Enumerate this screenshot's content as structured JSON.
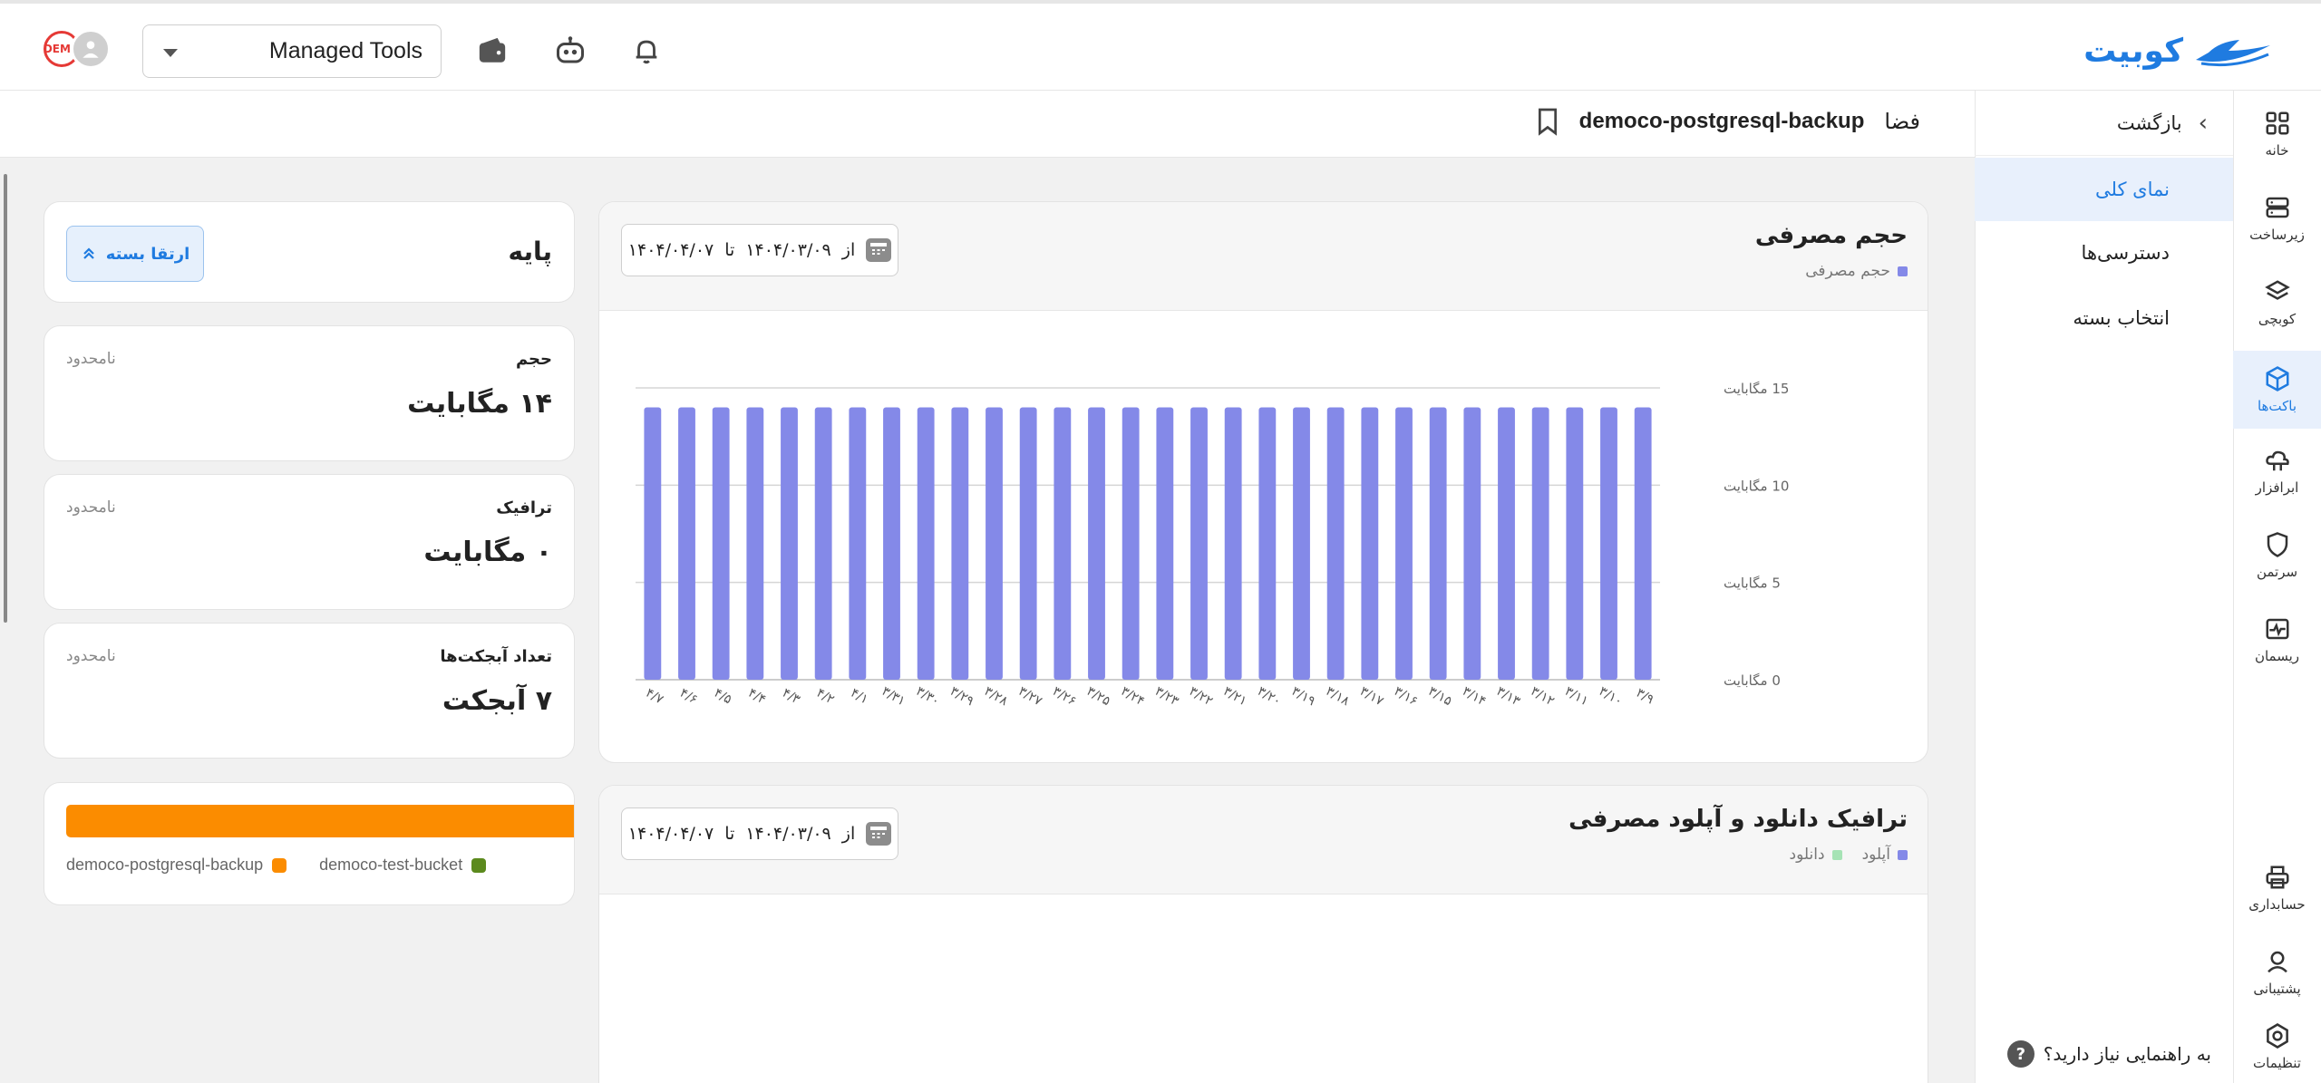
{
  "brand": {
    "name": "کوبیت",
    "color": "#1f7be0"
  },
  "header": {
    "org_select": "Managed Tools",
    "avatar_badge": "DEMO",
    "icons": [
      "wallet-icon",
      "robot-icon",
      "bell-icon"
    ]
  },
  "rail": {
    "items": [
      {
        "label": "خانه",
        "icon": "grid-icon",
        "active": false
      },
      {
        "label": "زیرساخت",
        "icon": "server-icon",
        "active": false
      },
      {
        "label": "کوبچی",
        "icon": "layers-icon",
        "active": false
      },
      {
        "label": "باکت‌ها",
        "icon": "box-icon",
        "active": true
      },
      {
        "label": "ابرافزار",
        "icon": "cloud-icon",
        "active": false
      },
      {
        "label": "سرتمن",
        "icon": "shield-icon",
        "active": false
      },
      {
        "label": "ریسمان",
        "icon": "pulse-icon",
        "active": false
      },
      {
        "label": "حسابداری",
        "icon": "printer-icon",
        "active": false
      },
      {
        "label": "پشتیبانی",
        "icon": "headset-icon",
        "active": false
      },
      {
        "label": "تنظیمات",
        "icon": "settings-icon",
        "active": false
      }
    ]
  },
  "subnav": {
    "back_label": "بازگشت",
    "items": [
      {
        "label": "نمای کلی",
        "active": true
      },
      {
        "label": "دسترسی‌ها",
        "active": false
      },
      {
        "label": "انتخاب بسته",
        "active": false
      }
    ],
    "help": "به راهنمایی نیاز دارید؟"
  },
  "breadcrumb": {
    "prefix": "فضا",
    "bucket": "democo-postgresql-backup"
  },
  "plan": {
    "name": "پایه",
    "upgrade_label": "ارتقا بسته"
  },
  "stats": [
    {
      "label": "حجم",
      "limit": "نامحدود",
      "value": "۱۴ مگابایت"
    },
    {
      "label": "ترافیک",
      "limit": "نامحدود",
      "value": "۰ مگابایت"
    },
    {
      "label": "تعداد آبجکت‌ها",
      "limit": "نامحدود",
      "value": "۷ آبجکت"
    }
  ],
  "bucket_usage": {
    "fill_fraction": 1.0,
    "fill_color": "#fb8c00",
    "legend": [
      {
        "name": "democo-test-bucket",
        "color": "#5c8a1e"
      },
      {
        "name": "democo-postgresql-backup",
        "color": "#fb8c00"
      }
    ]
  },
  "usage_chart": {
    "title": "حجم مصرفی",
    "legend": "حجم مصرفی",
    "date_from_label": "از",
    "date_from": "۱۴۰۴/۰۳/۰۹",
    "date_to_label": "تا",
    "date_to": "۱۴۰۴/۰۴/۰۷"
  },
  "traffic_chart": {
    "title": "ترافیک دانلود و آپلود مصرفی",
    "legend": [
      {
        "name": "آپلود",
        "color": "#8489e8"
      },
      {
        "name": "دانلود",
        "color": "#a6e3b5"
      }
    ],
    "date_from_label": "از",
    "date_from": "۱۴۰۴/۰۳/۰۹",
    "date_to_label": "تا",
    "date_to": "۱۴۰۴/۰۴/۰۷"
  },
  "chart_data": {
    "type": "bar",
    "title": "حجم مصرفی",
    "xlabel": "",
    "ylabel": "",
    "categories": [
      "۳/۹",
      "۳/۱۰",
      "۳/۱۱",
      "۳/۱۲",
      "۳/۱۳",
      "۳/۱۴",
      "۳/۱۵",
      "۳/۱۶",
      "۳/۱۷",
      "۳/۱۸",
      "۳/۱۹",
      "۳/۲۰",
      "۳/۲۱",
      "۳/۲۲",
      "۳/۲۳",
      "۳/۲۴",
      "۳/۲۵",
      "۳/۲۶",
      "۳/۲۷",
      "۳/۲۸",
      "۳/۲۹",
      "۳/۳۰",
      "۳/۳۱",
      "۴/۱",
      "۴/۲",
      "۴/۳",
      "۴/۴",
      "۴/۵",
      "۴/۶",
      "۴/۷"
    ],
    "series": [
      {
        "name": "حجم مصرفی",
        "values": [
          14,
          14,
          14,
          14,
          14,
          14,
          14,
          14,
          14,
          14,
          14,
          14,
          14,
          14,
          14,
          14,
          14,
          14,
          14,
          14,
          14,
          14,
          14,
          14,
          14,
          14,
          14,
          14,
          14,
          14
        ]
      }
    ],
    "ylim": [
      0,
      15
    ],
    "yticks": [
      "0 مگابایت",
      "5 مگابایت",
      "10 مگابایت",
      "15 مگابایت"
    ],
    "ytick_values": [
      0,
      5,
      10,
      15
    ],
    "x_direction": "right-to-left",
    "grid": true,
    "bar_color": "#8489e8"
  }
}
